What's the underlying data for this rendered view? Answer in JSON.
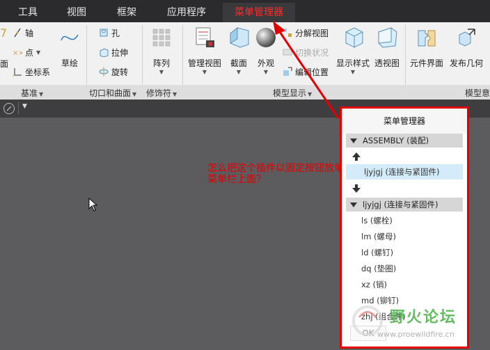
{
  "tabs": [
    {
      "label": "工具",
      "active": false
    },
    {
      "label": "视图",
      "active": false
    },
    {
      "label": "框架",
      "active": false
    },
    {
      "label": "应用程序",
      "active": false
    },
    {
      "label": "菜单管理器",
      "active": true
    }
  ],
  "ribbon": {
    "datum_items": {
      "axis": "轴",
      "point": "点",
      "csys": "坐标系",
      "sketch": "草绘",
      "cut_prefix": "面"
    },
    "cut_items": {
      "hole": "孔",
      "extrude": "拉伸",
      "revolve": "旋转"
    },
    "pattern": "阵列",
    "model_display": {
      "manage_views": "管理视图",
      "section": "截面",
      "appearance": "外观",
      "explode": "分解视图",
      "toggle_state": "切换状况",
      "edit_position": "编辑位置",
      "display_style": "显示样式",
      "perspective": "透视图"
    },
    "component_interface": "元件界面",
    "publish_geometry": "发布几何"
  },
  "group_labels": {
    "datum": "基准",
    "cut_surface": "切口和曲面",
    "modifiers": "修饰符",
    "model_display": "模型显示",
    "model_intent": "模型意"
  },
  "question": "怎么把这个插件以固定按钮放单菜单栏上面？",
  "dialog": {
    "title": "菜单管理器",
    "section1": "ASSEMBLY (装配)",
    "selected_item": "ljyjgj (连接与紧固件)",
    "section2": "ljyjgj (连接与紧固件)",
    "items": [
      "ls (螺栓)",
      "lm (螺母)",
      "ld (螺钉)",
      "dq (垫圈)",
      "xz (销)",
      "md (铆钉)",
      "zhj (组合件)"
    ],
    "ok_label": "OK"
  },
  "watermark": {
    "text": "野火论坛",
    "url": "www.proewildfire.cn"
  },
  "colors": {
    "accent_red": "#e30000",
    "tab_bar": "#2b2b2d",
    "canvas": "#5c5c5f",
    "selection": "#d4ecfa"
  }
}
